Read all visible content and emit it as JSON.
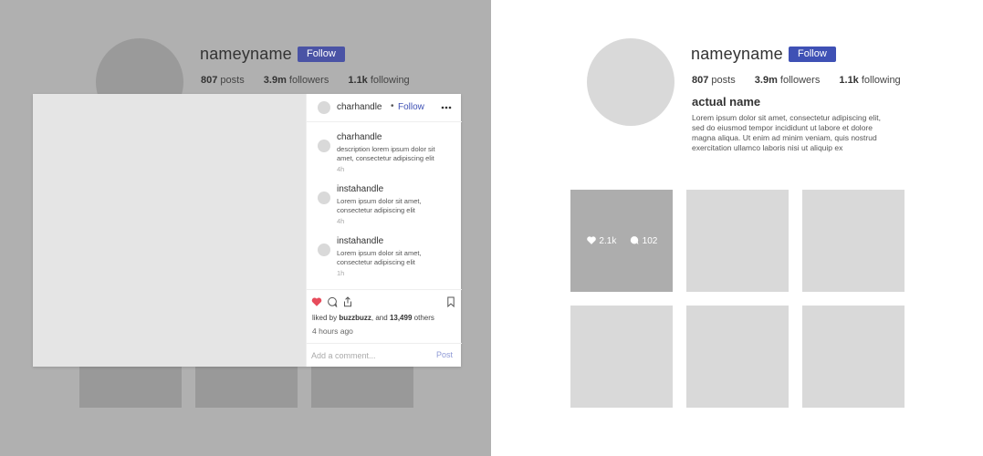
{
  "colors": {
    "accent": "#3f51b5",
    "accent_dimmed": "#4a53a5",
    "like_red": "#e74c5c",
    "overlay_bg": "#b0b0b0",
    "placeholder_gray": "#d9d9d9"
  },
  "profile": {
    "username": "nameyname",
    "follow_label": "Follow",
    "posts_count": "807",
    "posts_label": "posts",
    "followers_count": "3.9m",
    "followers_label": "followers",
    "following_count": "1.1k",
    "following_label": "following",
    "real_name": "actual name",
    "bio": "Lorem ipsum dolor sit amet, consectetur adipiscing elit, sed do eiusmod tempor incididunt ut labore et dolore magna aliqua. Ut enim ad minim veniam, quis nostrud exercitation ullamco laboris nisi ut aliquip ex"
  },
  "grid": {
    "hover_tile": {
      "likes": "2.1k",
      "comments": "102"
    }
  },
  "modal": {
    "author_handle": "charhandle",
    "separator": "•",
    "follow_label": "Follow",
    "more_icon": "more-horizontal-icon",
    "comments": [
      {
        "handle": "charhandle",
        "text": "description lorem ipsum dolor sit amet, consectetur adipiscing elit",
        "time": "4h"
      },
      {
        "handle": "instahandle",
        "text": "Lorem ipsum dolor sit amet, consectetur adipiscing elit",
        "time": "4h"
      },
      {
        "handle": "instahandle",
        "text": "Lorem ipsum dolor sit amet, consectetur adipiscing elit",
        "time": "1h"
      }
    ],
    "icons": [
      "heart-icon",
      "comment-icon",
      "share-icon",
      "bookmark-icon"
    ],
    "liked_by_prefix": "liked by",
    "liked_by_user": "buzzbuzz",
    "liked_by_mid": ", and",
    "liked_by_count": "13,499",
    "liked_by_suffix": "others",
    "time_ago": "4 hours ago",
    "comment_placeholder": "Add a comment...",
    "post_label": "Post"
  }
}
